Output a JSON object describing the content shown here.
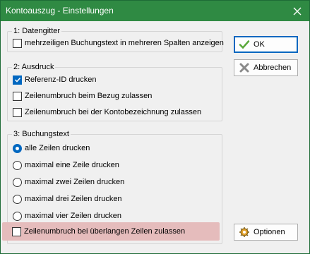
{
  "window": {
    "title": "Kontoauszug - Einstellungen"
  },
  "group1": {
    "legend": "1: Datengitter",
    "items": [
      {
        "label": "mehrzeiligen Buchungstext in mehreren Spalten anzeigen",
        "checked": false
      }
    ]
  },
  "group2": {
    "legend": "2: Ausdruck",
    "items": [
      {
        "label": "Referenz-ID drucken",
        "checked": true
      },
      {
        "label": "Zeilenumbruch beim Bezug zulassen",
        "checked": false
      },
      {
        "label": "Zeilenumbruch bei der Kontobezeichnung zulassen",
        "checked": false
      }
    ]
  },
  "group3": {
    "legend": "3: Buchungstext",
    "radios": [
      {
        "label": "alle Zeilen drucken",
        "checked": true
      },
      {
        "label": "maximal eine Zeile drucken",
        "checked": false
      },
      {
        "label": "maximal zwei Zeilen drucken",
        "checked": false
      },
      {
        "label": "maximal drei Zeilen drucken",
        "checked": false
      },
      {
        "label": "maximal vier Zeilen drucken",
        "checked": false
      }
    ],
    "checkbox": {
      "label": "Zeilenumbruch bei überlangen Zeilen zulassen",
      "checked": false
    }
  },
  "buttons": {
    "ok": "OK",
    "cancel": "Abbrechen",
    "options": "Optionen"
  },
  "colors": {
    "titlebar": "#2f8a43",
    "accent": "#0067c0",
    "highlight": "#e5bcbc"
  }
}
